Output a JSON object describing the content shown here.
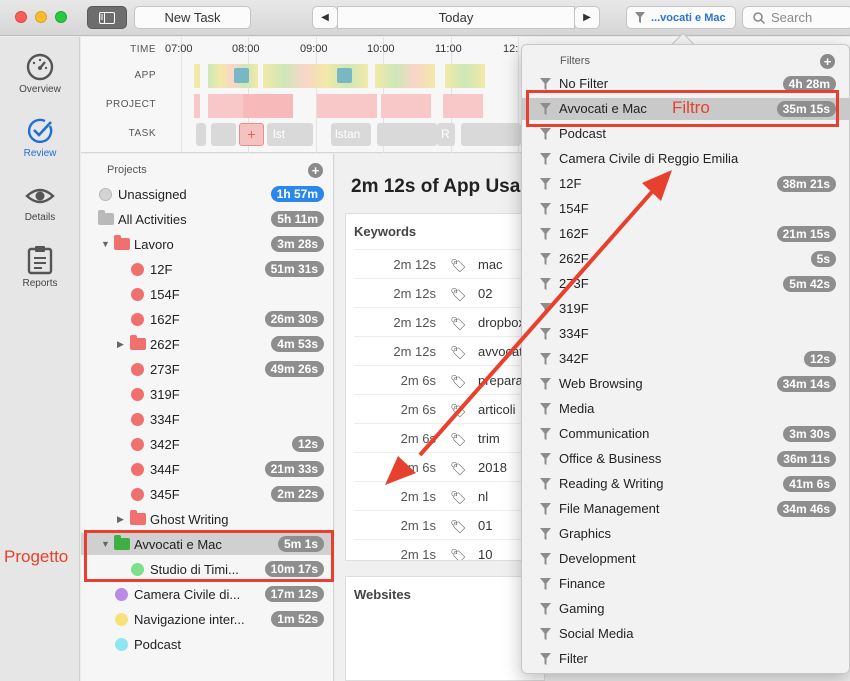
{
  "toolbar": {
    "new_task": "New Task",
    "today": "Today",
    "filter_label": "...vocati e Mac",
    "search_placeholder": "Search"
  },
  "leftnav": [
    {
      "label": "Overview",
      "icon": "gauge-icon"
    },
    {
      "label": "Review",
      "icon": "checkmark-icon"
    },
    {
      "label": "Details",
      "icon": "eye-icon"
    },
    {
      "label": "Reports",
      "icon": "clipboard-icon"
    }
  ],
  "timeline": {
    "labels": [
      "TIME",
      "APP",
      "PROJECT",
      "TASK"
    ],
    "hours": [
      "07:00",
      "08:00",
      "09:00",
      "10:00",
      "11:00",
      "12:"
    ],
    "task_labels": [
      "lst",
      "lstan",
      "R"
    ]
  },
  "projects": {
    "header": "Projects",
    "rows": [
      {
        "name": "Unassigned",
        "badge": "1h 57m"
      },
      {
        "name": "All Activities",
        "badge": "5h 11m"
      },
      {
        "name": "Lavoro",
        "badge": "3m 28s"
      },
      {
        "name": "12F",
        "badge": "51m 31s"
      },
      {
        "name": "154F",
        "badge": ""
      },
      {
        "name": "162F",
        "badge": "26m 30s"
      },
      {
        "name": "262F",
        "badge": "4m 53s"
      },
      {
        "name": "273F",
        "badge": "49m 26s"
      },
      {
        "name": "319F",
        "badge": ""
      },
      {
        "name": "334F",
        "badge": ""
      },
      {
        "name": "342F",
        "badge": "12s"
      },
      {
        "name": "344F",
        "badge": "21m 33s"
      },
      {
        "name": "345F",
        "badge": "2m 22s"
      },
      {
        "name": "Ghost Writing",
        "badge": ""
      },
      {
        "name": "Avvocati e Mac",
        "badge": "5m 1s"
      },
      {
        "name": "Studio di Timi...",
        "badge": "10m 17s"
      },
      {
        "name": "Camera Civile di...",
        "badge": "17m 12s"
      },
      {
        "name": "Navigazione inter...",
        "badge": "1m 52s"
      },
      {
        "name": "Podcast",
        "badge": ""
      }
    ]
  },
  "main": {
    "title": "2m 12s of App Usa",
    "keywords_title": "Keywords",
    "websites_title": "Websites",
    "keywords": [
      {
        "dur": "2m 12s",
        "kw": "mac"
      },
      {
        "dur": "2m 12s",
        "kw": "02"
      },
      {
        "dur": "2m 12s",
        "kw": "dropbox"
      },
      {
        "dur": "2m 12s",
        "kw": "avvocati"
      },
      {
        "dur": "2m 6s",
        "kw": "preparaz"
      },
      {
        "dur": "2m 6s",
        "kw": "articoli"
      },
      {
        "dur": "2m 6s",
        "kw": "trim"
      },
      {
        "dur": "2m 6s",
        "kw": "2018"
      },
      {
        "dur": "2m 1s",
        "kw": "nl"
      },
      {
        "dur": "2m 1s",
        "kw": "01"
      },
      {
        "dur": "2m 1s",
        "kw": "10"
      }
    ]
  },
  "filters": {
    "header": "Filters",
    "rows": [
      {
        "name": "No Filter",
        "badge": "4h 28m"
      },
      {
        "name": "Avvocati e Mac",
        "badge": "35m 15s"
      },
      {
        "name": "Podcast",
        "badge": ""
      },
      {
        "name": "Camera Civile di Reggio Emilia",
        "badge": ""
      },
      {
        "name": "12F",
        "badge": "38m 21s"
      },
      {
        "name": "154F",
        "badge": ""
      },
      {
        "name": "162F",
        "badge": "21m 15s"
      },
      {
        "name": "262F",
        "badge": "5s"
      },
      {
        "name": "273F",
        "badge": "5m 42s"
      },
      {
        "name": "319F",
        "badge": ""
      },
      {
        "name": "334F",
        "badge": ""
      },
      {
        "name": "342F",
        "badge": "12s"
      },
      {
        "name": "Web Browsing",
        "badge": "34m 14s"
      },
      {
        "name": "Media",
        "badge": ""
      },
      {
        "name": "Communication",
        "badge": "3m 30s"
      },
      {
        "name": "Office & Business",
        "badge": "36m 11s"
      },
      {
        "name": "Reading & Writing",
        "badge": "41m 6s"
      },
      {
        "name": "File Management",
        "badge": "34m 46s"
      },
      {
        "name": "Graphics",
        "badge": ""
      },
      {
        "name": "Development",
        "badge": ""
      },
      {
        "name": "Finance",
        "badge": ""
      },
      {
        "name": "Gaming",
        "badge": ""
      },
      {
        "name": "Social Media",
        "badge": ""
      },
      {
        "name": "Filter",
        "badge": ""
      }
    ]
  },
  "annotations": {
    "filtro": "Filtro",
    "progetto": "Progetto"
  },
  "colors": {
    "accent": "#2b87e9",
    "annotation": "#e8402e",
    "project_red": "#f07070",
    "folder_green": "#3cb043"
  }
}
